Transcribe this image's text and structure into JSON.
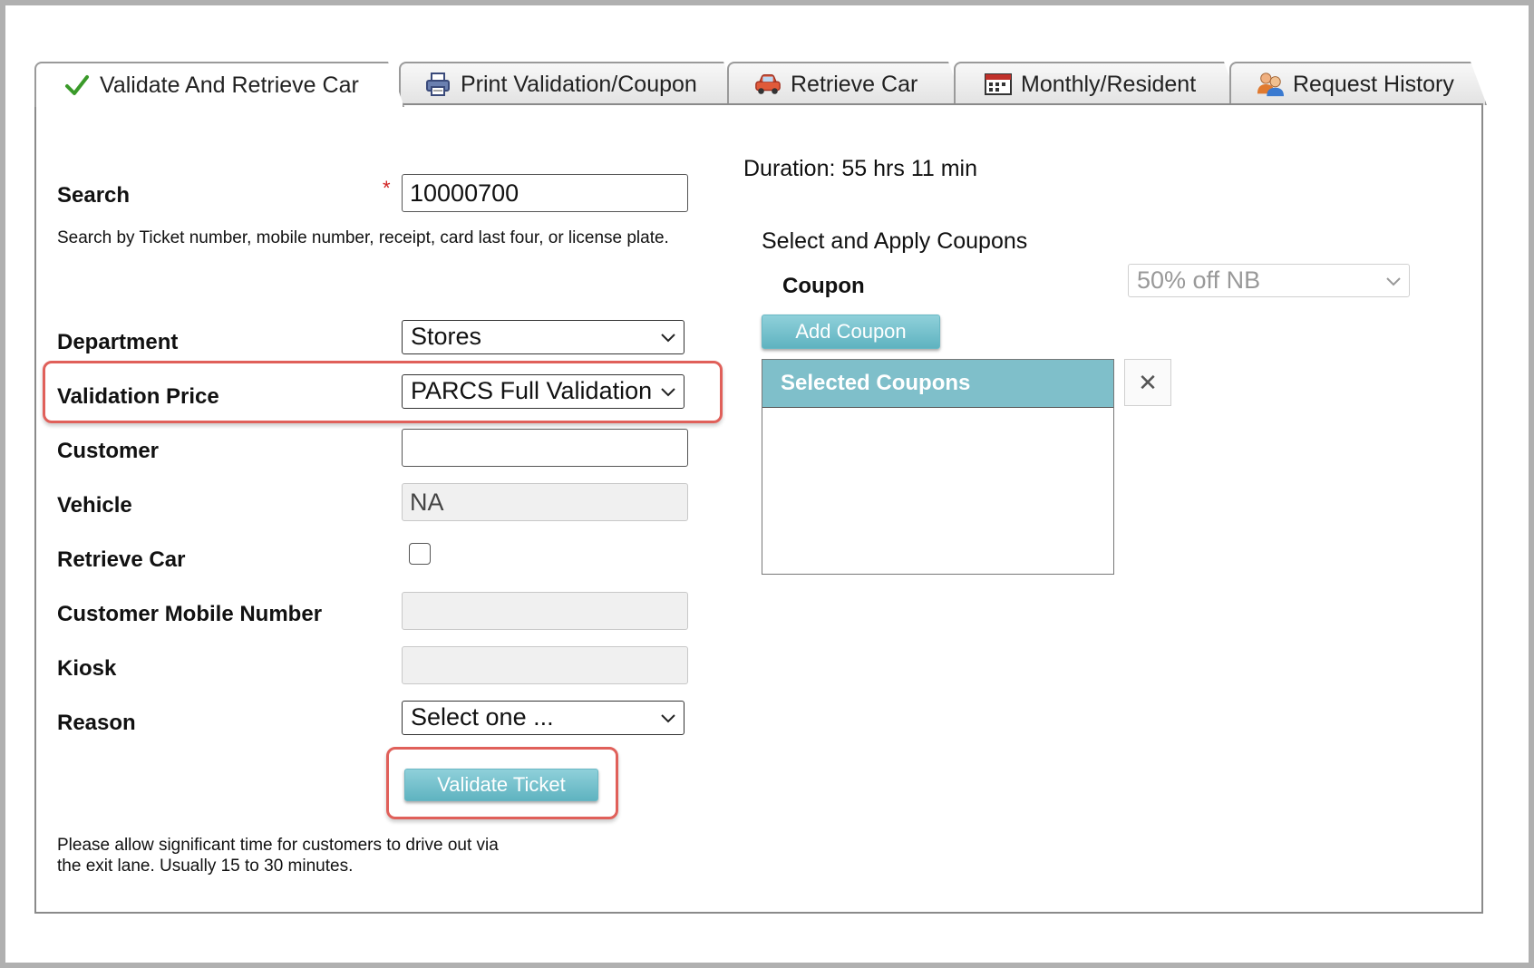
{
  "tabs": [
    {
      "label": "Validate And Retrieve Car",
      "icon": "check-icon",
      "active": true
    },
    {
      "label": "Print Validation/Coupon",
      "icon": "printer-icon"
    },
    {
      "label": "Retrieve Car",
      "icon": "car-icon"
    },
    {
      "label": "Monthly/Resident",
      "icon": "calendar-icon"
    },
    {
      "label": "Request History",
      "icon": "users-icon"
    }
  ],
  "form": {
    "search_label": "Search",
    "required_mark": "*",
    "search_value": "10000700",
    "search_hint": "Search by Ticket number, mobile number, receipt, card last four, or license plate.",
    "department_label": "Department",
    "department_value": "Stores",
    "validation_price_label": "Validation Price",
    "validation_price_value": "PARCS Full Validation",
    "customer_label": "Customer",
    "customer_value": "",
    "vehicle_label": "Vehicle",
    "vehicle_value": "NA",
    "retrieve_car_label": "Retrieve Car",
    "retrieve_car_checked": false,
    "mobile_label": "Customer Mobile Number",
    "mobile_value": "",
    "kiosk_label": "Kiosk",
    "kiosk_value": "",
    "reason_label": "Reason",
    "reason_value": "Select one ...",
    "validate_button": "Validate Ticket",
    "note_line1": "Please allow significant time for customers to drive out via",
    "note_line2": "the exit lane. Usually 15 to 30 minutes."
  },
  "coupons": {
    "duration": "Duration: 55 hrs 11 min",
    "heading": "Select and Apply Coupons",
    "coupon_label": "Coupon",
    "coupon_value": "50% off NB",
    "add_button": "Add Coupon",
    "selected_header": "Selected Coupons",
    "close_symbol": "✕"
  },
  "colors": {
    "accent": "#7fbfca",
    "highlight": "#e0605a",
    "check": "#3a9a2a"
  }
}
